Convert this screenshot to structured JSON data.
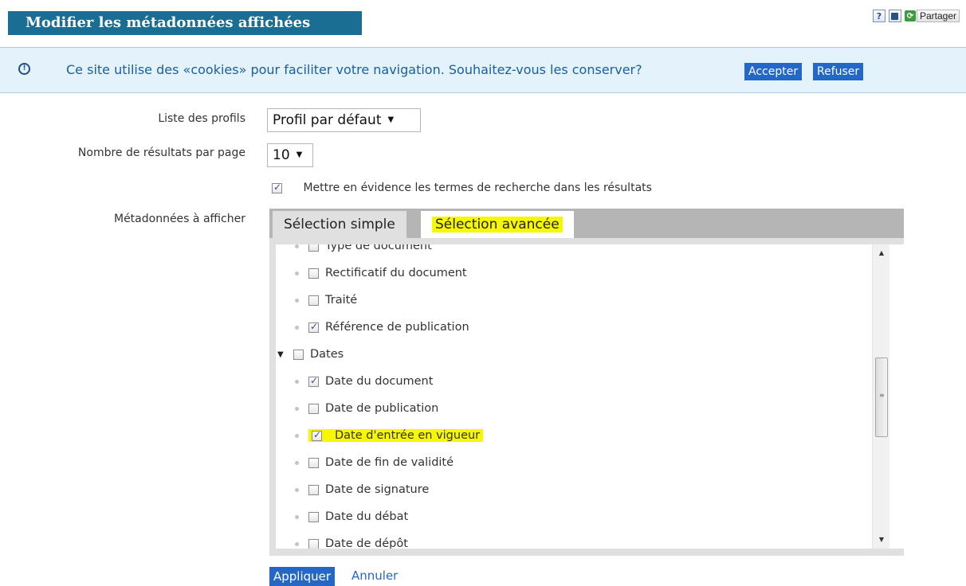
{
  "header": {
    "title": "Modifier les métadonnées affichées",
    "help_label": "?",
    "print_label": "🖶",
    "share_label": "Partager"
  },
  "cookie": {
    "icon": "info-icon",
    "message": "Ce site utilise des «cookies» pour faciliter votre navigation. Souhaitez-vous les conserver?",
    "accept_label": "Accepter",
    "refuse_label": "Refuser"
  },
  "form": {
    "profiles_label": "Liste des profils",
    "profiles_value": "Profil par défaut",
    "results_label": "Nombre de résultats par page",
    "results_value": "10",
    "highlight_terms_label": "Mettre en évidence les termes de recherche dans les résultats",
    "highlight_terms_checked": true,
    "metadata_label": "Métadonnées à afficher"
  },
  "tabs": {
    "simple_label": "Sélection simple",
    "advanced_label": "Sélection avancée",
    "active": "advanced"
  },
  "tree": {
    "items": [
      {
        "label": "Type de document",
        "checked": false
      },
      {
        "label": "Rectificatif du document",
        "checked": false
      },
      {
        "label": "Traité",
        "checked": false
      },
      {
        "label": "Référence de publication",
        "checked": true
      },
      {
        "label": "Dates",
        "checked": false,
        "group": true,
        "expanded": true
      },
      {
        "label": "Date du document",
        "checked": true
      },
      {
        "label": "Date de publication",
        "checked": false
      },
      {
        "label": "Date d'entrée en vigueur",
        "checked": true,
        "highlighted": true
      },
      {
        "label": "Date de fin de validité",
        "checked": false
      },
      {
        "label": "Date de signature",
        "checked": false
      },
      {
        "label": "Date du débat",
        "checked": false
      },
      {
        "label": "Date de dépôt",
        "checked": false
      }
    ]
  },
  "actions": {
    "apply_label": "Appliquer",
    "cancel_label": "Annuler"
  },
  "colors": {
    "title_bg": "#1a6e94",
    "button_bg": "#2567c8",
    "highlight": "#f7f700",
    "banner_bg": "#e4f2fb"
  }
}
